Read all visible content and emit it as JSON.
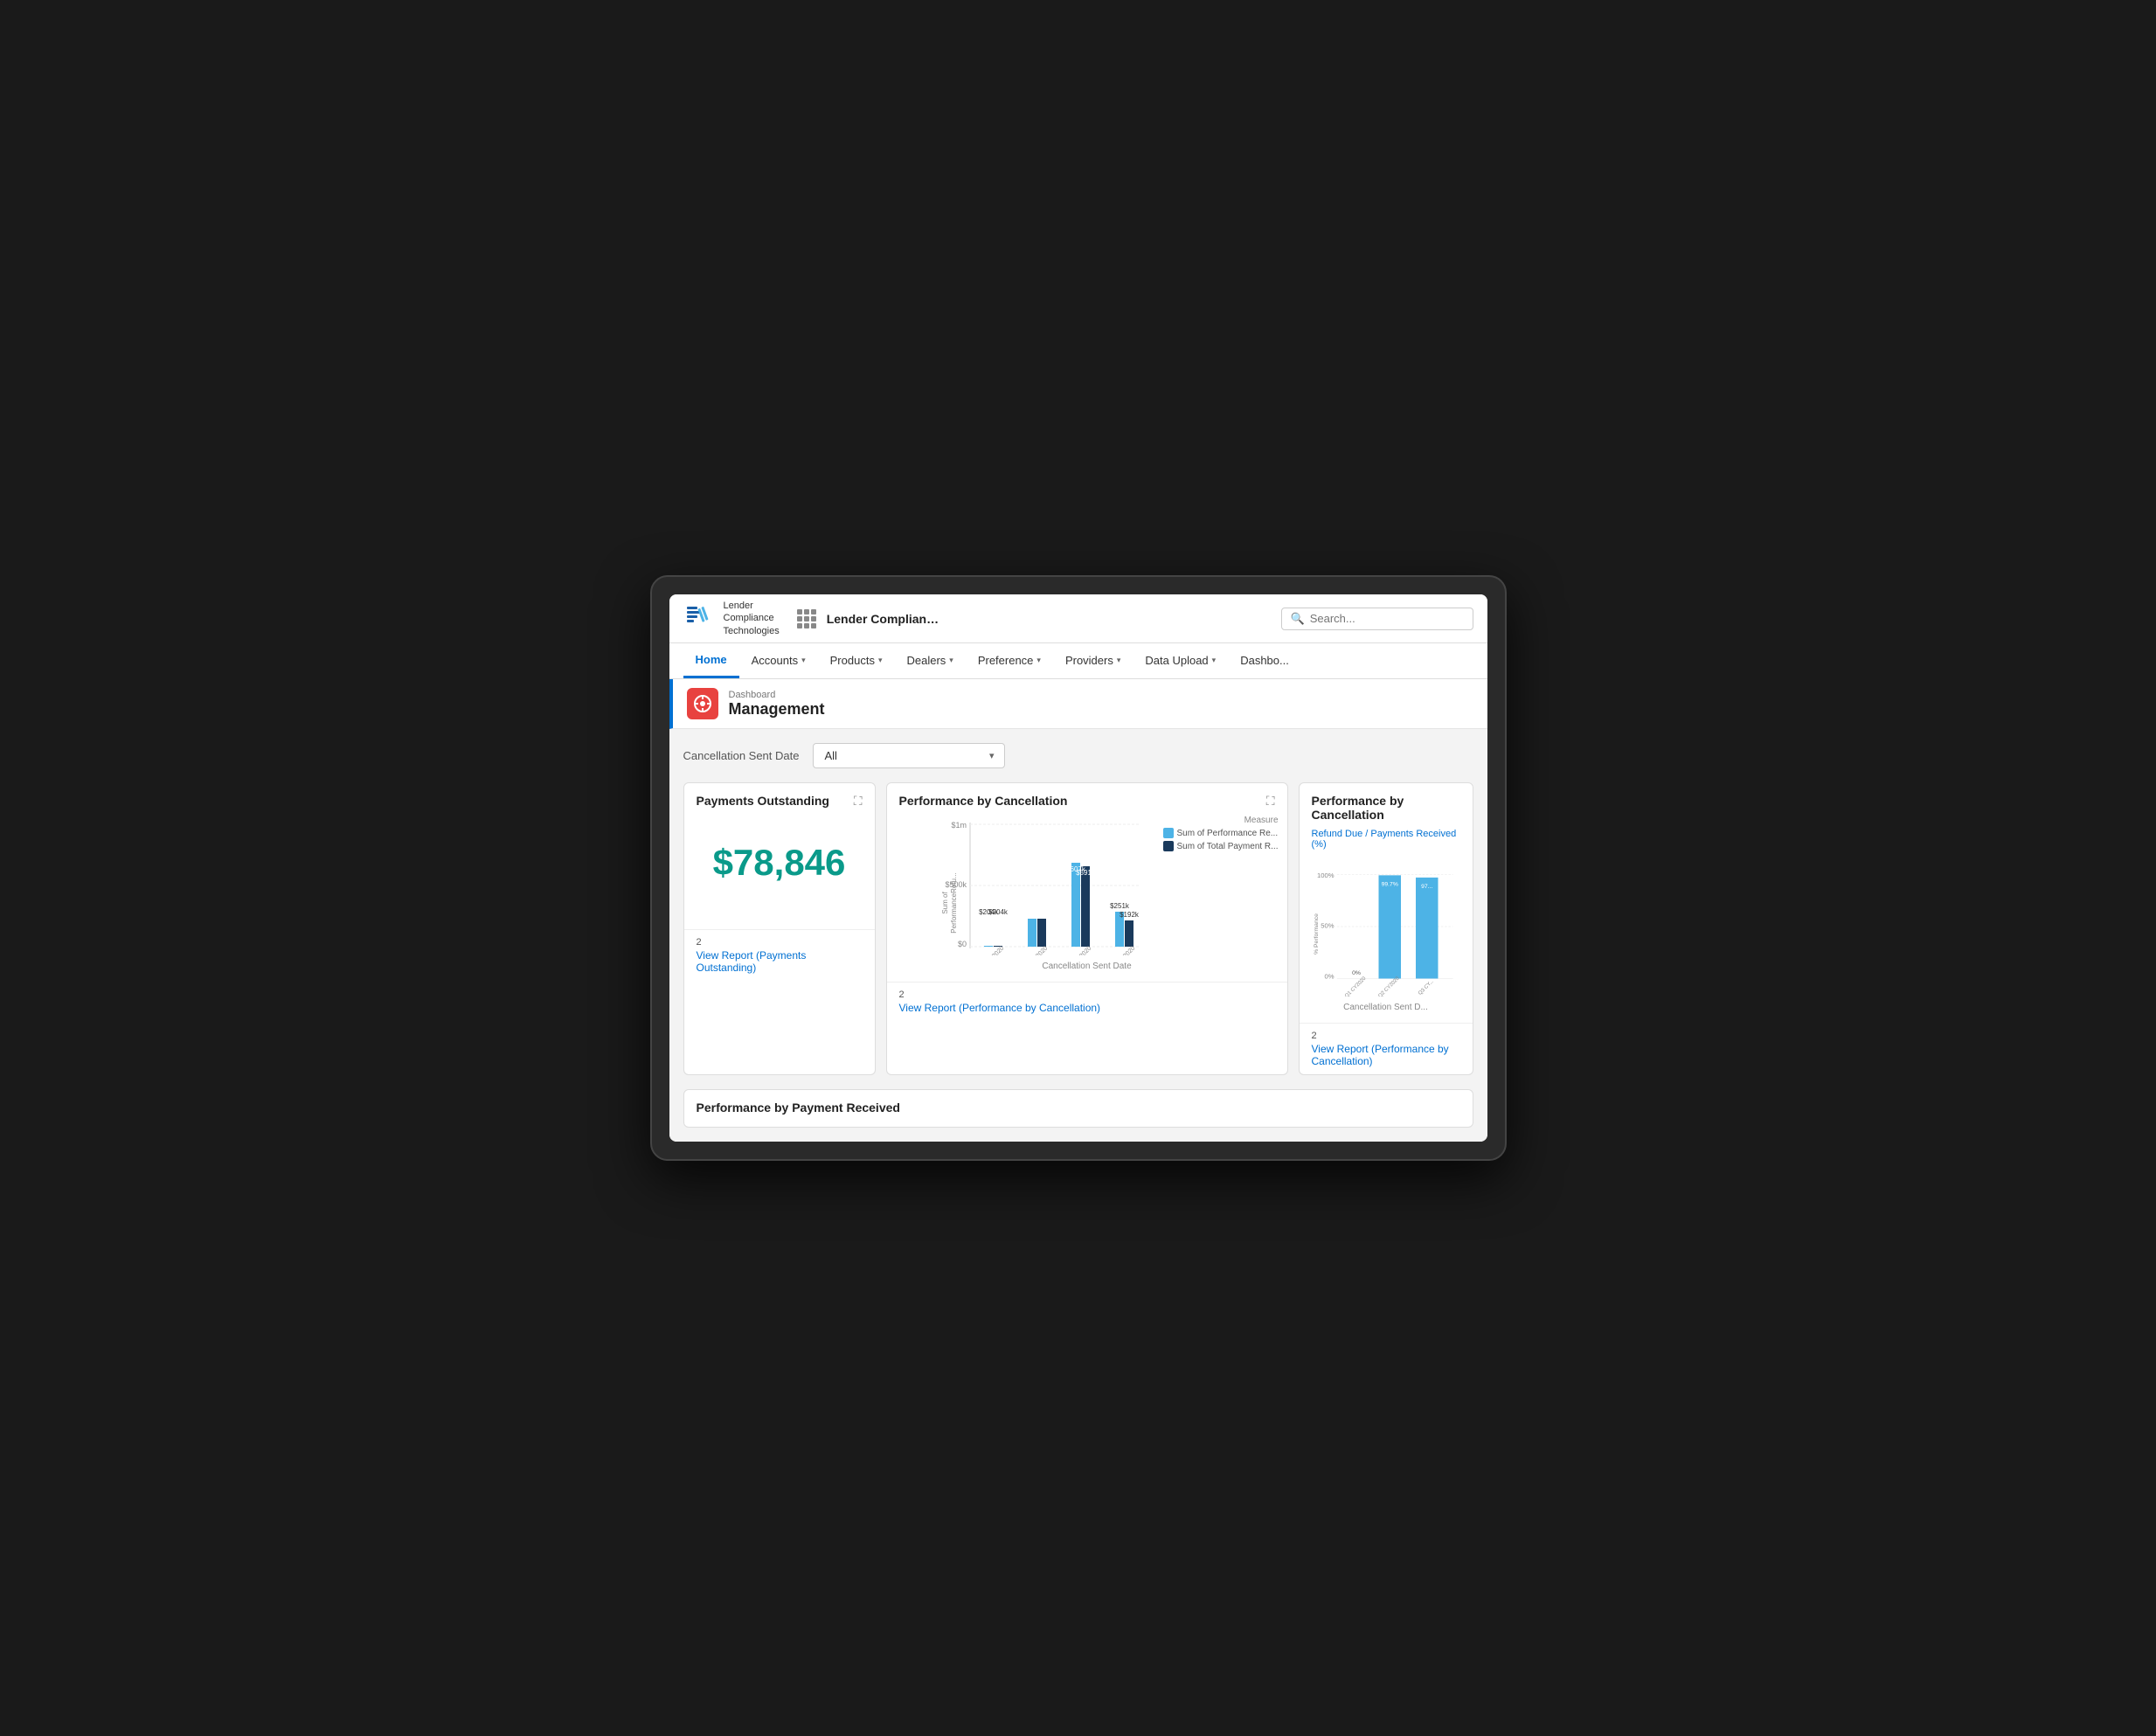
{
  "app": {
    "logo_lines": [
      "Lender",
      "Compliance",
      "Technologies"
    ],
    "title": "Lender Complianc...",
    "search_placeholder": "Search..."
  },
  "nav": {
    "items": [
      {
        "label": "Home",
        "active": true
      },
      {
        "label": "Accounts",
        "has_dropdown": true
      },
      {
        "label": "Products",
        "has_dropdown": true
      },
      {
        "label": "Dealers",
        "has_dropdown": true
      },
      {
        "label": "Preference",
        "has_dropdown": true
      },
      {
        "label": "Providers",
        "has_dropdown": true
      },
      {
        "label": "Data Upload",
        "has_dropdown": true
      },
      {
        "label": "Dashbo...",
        "has_dropdown": false
      }
    ]
  },
  "page": {
    "breadcrumb": "Dashboard",
    "title": "Management",
    "icon": "⚙"
  },
  "filter": {
    "label": "Cancellation Sent Date",
    "value": "All"
  },
  "cards": {
    "payments_outstanding": {
      "title": "Payments Outstanding",
      "value": "$78,846",
      "footer_count": "2",
      "footer_link": "View Report (Payments Outstanding)"
    },
    "performance_by_cancellation": {
      "title": "Performance by Cancellation",
      "measure_label": "Measure",
      "legend": [
        {
          "label": "Sum of Performance Re...",
          "color": "#4db3e6"
        },
        {
          "label": "Sum of Total Payment R...",
          "color": "#1a3a5c"
        }
      ],
      "x_label": "Cancellation Sent Date",
      "y_label": "Sum of\nPerformanceRefu...",
      "y_ticks": [
        "$1m",
        "$500k",
        "$0"
      ],
      "bars": [
        {
          "quarter": "Q1 CY2020",
          "perf": 0,
          "total": 0,
          "perf_label": "$0",
          "total_label": "$0"
        },
        {
          "quarter": "Q2 CY2020",
          "perf": 204,
          "total": 204,
          "perf_label": "$204k",
          "total_label": "$204k"
        },
        {
          "quarter": "Q3 CY2020",
          "perf": 607,
          "total": 591,
          "perf_label": "$607k",
          "total_label": "$591k"
        },
        {
          "quarter": "Q4 CY2020",
          "perf": 251,
          "total": 192,
          "perf_label": "$251k",
          "total_label": "$192k"
        }
      ],
      "footer_count": "2",
      "footer_link": "View Report (Performance by Cancellation)"
    },
    "performance_refund": {
      "title": "Performance by Cancellation",
      "subtitle": "Refund Due / Payments Received (%)",
      "x_label": "Cancellation Sent D...",
      "y_ticks": [
        "100%",
        "50%",
        "0%"
      ],
      "bars": [
        {
          "quarter": "Q1 CY2020",
          "value": 0,
          "label": "0%"
        },
        {
          "quarter": "Q2 CY2020",
          "value": 99.7,
          "label": "99.7%"
        },
        {
          "quarter": "Q3 CY2020",
          "value": 97,
          "label": "97..."
        }
      ],
      "footer_count": "2",
      "footer_link": "View Report (Performance by Cancellation)"
    }
  },
  "bottom": {
    "title": "Performance by Payment Received"
  }
}
